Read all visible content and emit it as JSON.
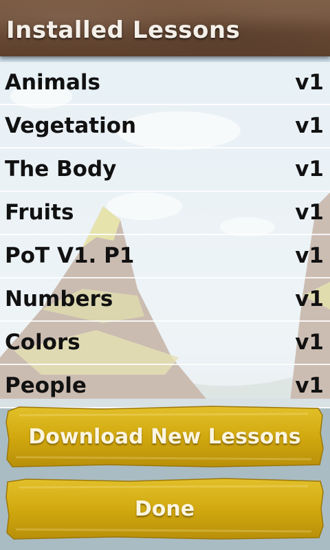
{
  "header": {
    "title": "Installed Lessons"
  },
  "lessons": [
    {
      "name": "Animals",
      "version": "v1"
    },
    {
      "name": "Vegetation",
      "version": "v1"
    },
    {
      "name": "The Body",
      "version": "v1"
    },
    {
      "name": "Fruits",
      "version": "v1"
    },
    {
      "name": "PoT V1. P1",
      "version": "v1"
    },
    {
      "name": "Numbers",
      "version": "v1"
    },
    {
      "name": "Colors",
      "version": "v1"
    },
    {
      "name": "People",
      "version": "v1"
    }
  ],
  "buttons": {
    "download_label": "Download New Lessons",
    "done_label": "Done"
  },
  "colors": {
    "header_wood": "#6a4b36",
    "button_gold": "#d4ad12",
    "text_dark": "#111111",
    "text_light": "#fbf5e0"
  }
}
